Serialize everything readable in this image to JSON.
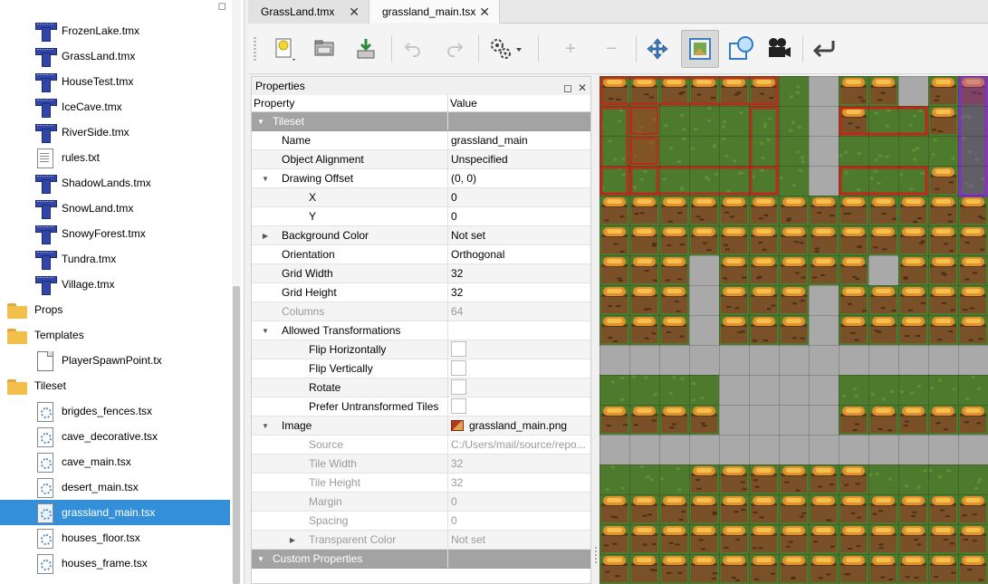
{
  "tabs": [
    {
      "label": "GrassLand.tmx",
      "active": false
    },
    {
      "label": "grassland_main.tsx",
      "active": true
    }
  ],
  "project_tree": [
    {
      "label": "FrozenLake.tmx",
      "type": "tmx",
      "level": 1
    },
    {
      "label": "GrassLand.tmx",
      "type": "tmx",
      "level": 1
    },
    {
      "label": "HouseTest.tmx",
      "type": "tmx",
      "level": 1
    },
    {
      "label": "IceCave.tmx",
      "type": "tmx",
      "level": 1
    },
    {
      "label": "RiverSide.tmx",
      "type": "tmx",
      "level": 1
    },
    {
      "label": "rules.txt",
      "type": "txt",
      "level": 1
    },
    {
      "label": "ShadowLands.tmx",
      "type": "tmx",
      "level": 1
    },
    {
      "label": "SnowLand.tmx",
      "type": "tmx",
      "level": 1
    },
    {
      "label": "SnowyForest.tmx",
      "type": "tmx",
      "level": 1
    },
    {
      "label": "Tundra.tmx",
      "type": "tmx",
      "level": 1
    },
    {
      "label": "Village.tmx",
      "type": "tmx",
      "level": 1
    },
    {
      "label": "Props",
      "type": "folder",
      "level": 0
    },
    {
      "label": "Templates",
      "type": "folder",
      "level": 0
    },
    {
      "label": "PlayerSpawnPoint.tx",
      "type": "tx",
      "level": 1
    },
    {
      "label": "Tileset",
      "type": "folder",
      "level": 0
    },
    {
      "label": "brigdes_fences.tsx",
      "type": "tsx",
      "level": 1
    },
    {
      "label": "cave_decorative.tsx",
      "type": "tsx",
      "level": 1
    },
    {
      "label": "cave_main.tsx",
      "type": "tsx",
      "level": 1
    },
    {
      "label": "desert_main.tsx",
      "type": "tsx",
      "level": 1
    },
    {
      "label": "grassland_main.tsx",
      "type": "tsx",
      "level": 1,
      "selected": true
    },
    {
      "label": "houses_floor.tsx",
      "type": "tsx",
      "level": 1
    },
    {
      "label": "houses_frame.tsx",
      "type": "tsx",
      "level": 1
    }
  ],
  "toolbar": [
    {
      "name": "new-tileset-button",
      "icon": "new-file-icon",
      "has_menu": true
    },
    {
      "name": "open-button",
      "icon": "folder-open-icon"
    },
    {
      "name": "save-button",
      "icon": "save-icon"
    },
    {
      "name": "undo-button",
      "icon": "undo-icon",
      "enabled": false
    },
    {
      "name": "redo-button",
      "icon": "redo-icon",
      "enabled": false
    },
    {
      "name": "tileset-properties-button",
      "icon": "gears-icon",
      "has_menu": true
    },
    {
      "name": "add-tiles-button",
      "icon": "plus-icon",
      "enabled": false
    },
    {
      "name": "remove-tiles-button",
      "icon": "minus-icon",
      "enabled": false
    },
    {
      "name": "rearrange-tiles-button",
      "icon": "move-icon"
    },
    {
      "name": "edit-terrain-button",
      "icon": "terrain-icon",
      "active": true
    },
    {
      "name": "edit-collision-button",
      "icon": "collision-icon"
    },
    {
      "name": "edit-animation-button",
      "icon": "camera-icon"
    },
    {
      "name": "back-button",
      "icon": "return-arrow-icon"
    }
  ],
  "properties": {
    "title": "Properties",
    "col_property": "Property",
    "col_value": "Value",
    "rows": [
      {
        "label": "Tileset",
        "value": "",
        "kind": "group",
        "expanded": true
      },
      {
        "label": "Name",
        "value": "grassland_main",
        "indent": 1
      },
      {
        "label": "Object Alignment",
        "value": "Unspecified",
        "indent": 1
      },
      {
        "label": "Drawing Offset",
        "value": "(0, 0)",
        "indent": 1,
        "expander": "open"
      },
      {
        "label": "X",
        "value": "0",
        "indent": 2
      },
      {
        "label": "Y",
        "value": "0",
        "indent": 2
      },
      {
        "label": "Background Color",
        "value": "Not set",
        "indent": 1,
        "expander": "closed"
      },
      {
        "label": "Orientation",
        "value": "Orthogonal",
        "indent": 1
      },
      {
        "label": "Grid Width",
        "value": "32",
        "indent": 1
      },
      {
        "label": "Grid Height",
        "value": "32",
        "indent": 1
      },
      {
        "label": "Columns",
        "value": "64",
        "indent": 1,
        "disabled": true
      },
      {
        "label": "Allowed Transformations",
        "value": "",
        "indent": 1,
        "expander": "open"
      },
      {
        "label": "Flip Horizontally",
        "value": "",
        "indent": 2,
        "checkbox": true,
        "checked": false
      },
      {
        "label": "Flip Vertically",
        "value": "",
        "indent": 2,
        "checkbox": true,
        "checked": false
      },
      {
        "label": "Rotate",
        "value": "",
        "indent": 2,
        "checkbox": true,
        "checked": false
      },
      {
        "label": "Prefer Untransformed Tiles",
        "value": "",
        "indent": 2,
        "checkbox": true,
        "checked": false
      },
      {
        "label": "Image",
        "value": "grassland_main.png",
        "indent": 1,
        "expander": "open",
        "image": true
      },
      {
        "label": "Source",
        "value": "C:/Users/mail/source/repo...",
        "indent": 2,
        "disabled": true
      },
      {
        "label": "Tile Width",
        "value": "32",
        "indent": 2,
        "disabled": true
      },
      {
        "label": "Tile Height",
        "value": "32",
        "indent": 2,
        "disabled": true
      },
      {
        "label": "Margin",
        "value": "0",
        "indent": 2,
        "disabled": true
      },
      {
        "label": "Spacing",
        "value": "0",
        "indent": 2,
        "disabled": true
      },
      {
        "label": "Transparent Color",
        "value": "Not set",
        "indent": 2,
        "disabled": true,
        "expander": "closed"
      },
      {
        "label": "Custom Properties",
        "value": "",
        "kind": "group",
        "expanded": true
      }
    ]
  },
  "colors": {
    "selection": "#3390d8",
    "group_header": "#a3a3a3",
    "grass": "#4e7a2e",
    "dirt": "#7a5028",
    "terrain_red": "#c0261a",
    "terrain_purple": "#8a2bd0",
    "path_gray": "#a9a9a9"
  }
}
